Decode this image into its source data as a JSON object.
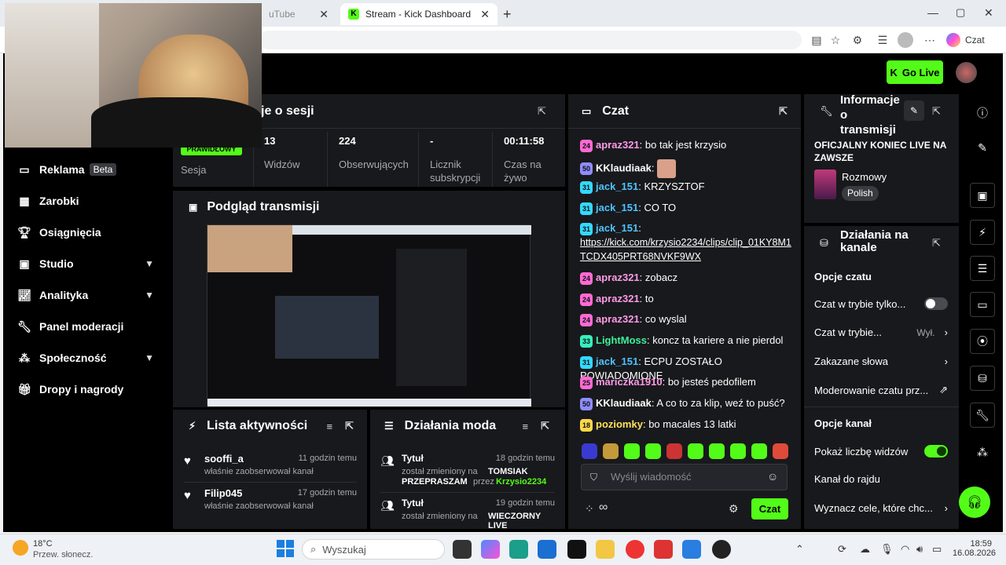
{
  "browser": {
    "tabs": [
      {
        "label": "uTube",
        "active": false
      },
      {
        "label": "Stream - Kick Dashboard",
        "active": true
      }
    ],
    "profile_label": "Czat"
  },
  "header": {
    "go_live_label": "Go Live"
  },
  "sidebar": {
    "items": [
      {
        "label": "Reklama",
        "badge": "Beta",
        "icon": "ad-icon"
      },
      {
        "label": "Zarobki",
        "icon": "money-icon"
      },
      {
        "label": "Osiągnięcia",
        "icon": "trophy-icon"
      },
      {
        "label": "Studio",
        "icon": "studio-icon",
        "expandable": true
      },
      {
        "label": "Analityka",
        "icon": "chart-icon",
        "expandable": true
      },
      {
        "label": "Panel moderacji",
        "icon": "wrench-icon"
      },
      {
        "label": "Społeczność",
        "icon": "community-icon",
        "expandable": true
      },
      {
        "label": "Dropy i nagrody",
        "icon": "gift-icon"
      }
    ]
  },
  "session": {
    "title": "je o sesji",
    "status_badge": "PRAWIDŁOWY",
    "stats": [
      {
        "value": "",
        "label": "Sesja"
      },
      {
        "value": "13",
        "label": "Widzów"
      },
      {
        "value": "224",
        "label": "Obserwujących"
      },
      {
        "value": "-",
        "label": "Licznik subskrypcji"
      },
      {
        "value": "00:11:58",
        "label": "Czas na żywo"
      }
    ]
  },
  "preview": {
    "title": "Podgląd transmisji"
  },
  "activity": {
    "title": "Lista aktywności",
    "items": [
      {
        "user": "sooffi_a",
        "time": "11 godzin temu",
        "text": "właśnie zaobserwował kanał"
      },
      {
        "user": "Filip045",
        "time": "17 godzin temu",
        "text": "właśnie zaobserwował kanał"
      }
    ]
  },
  "mod_actions": {
    "title": "Działania moda",
    "items": [
      {
        "title": "Tytuł",
        "time": "18 godzin temu",
        "line1": "został zmieniony na",
        "bold1": "TOMSIAK",
        "line2": "PRZEPRASZAM",
        "by": "przez",
        "mod": "Krzysio2234"
      },
      {
        "title": "Tytuł",
        "time": "19 godzin temu",
        "line1": "został zmieniony na",
        "bold1": "WIECZORNY LIVE"
      }
    ]
  },
  "chat": {
    "title": "Czat",
    "messages": [
      {
        "badge": "24",
        "badge_color": "#ff6ad5",
        "user": "apraz321",
        "user_color": "#ff9ae8",
        "text": "bo tak jest krzysio"
      },
      {
        "badge": "50",
        "badge_color": "#8f8cff",
        "user": "KKlaudiaak",
        "user_color": "#ffffff",
        "text": ""
      },
      {
        "badge": "31",
        "badge_color": "#34d9ff",
        "user": "jack_151",
        "user_color": "#4fc3ff",
        "text": "KRZYSZTOF"
      },
      {
        "badge": "31",
        "badge_color": "#34d9ff",
        "user": "jack_151",
        "user_color": "#4fc3ff",
        "text": "CO TO"
      },
      {
        "badge": "31",
        "badge_color": "#34d9ff",
        "user": "jack_151",
        "user_color": "#4fc3ff",
        "text": "",
        "link": "https://kick.com/krzysio2234/clips/clip_01KY8M1TCDX405PRT68NVKF9WX"
      },
      {
        "badge": "24",
        "badge_color": "#ff6ad5",
        "user": "apraz321",
        "user_color": "#ff9ae8",
        "text": "zobacz"
      },
      {
        "badge": "24",
        "badge_color": "#ff6ad5",
        "user": "apraz321",
        "user_color": "#ff9ae8",
        "text": "to"
      },
      {
        "badge": "24",
        "badge_color": "#ff6ad5",
        "user": "apraz321",
        "user_color": "#ff9ae8",
        "text": "co wyslal"
      },
      {
        "badge": "33",
        "badge_color": "#36f0c0",
        "user": "LightMoss",
        "user_color": "#3ef09a",
        "text": "koncz ta kariere a nie pierdol"
      },
      {
        "badge": "31",
        "badge_color": "#34d9ff",
        "user": "jack_151",
        "user_color": "#4fc3ff",
        "text": "ECPU ZOSTAŁO POWIADOMIONE"
      },
      {
        "badge": "25",
        "badge_color": "#ff6ad5",
        "user": "mariczka1910",
        "user_color": "#ff9ae8",
        "text": "bo jesteś pedofilem"
      },
      {
        "badge": "50",
        "badge_color": "#8f8cff",
        "user": "KKlaudiaak",
        "user_color": "#ffffff",
        "text": "A co to za klip, weź to puść?"
      },
      {
        "badge": "18",
        "badge_color": "#ffd84a",
        "user": "poziomky",
        "user_color": "#ffe25a",
        "text": "bo macales 13 latki"
      }
    ],
    "input_placeholder": "Wyślij wiadomość",
    "send_label": "Czat"
  },
  "stream_info": {
    "title": "Informacje o transmisji",
    "stream_title": "OFICJALNY KONIEC LIVE NA ZAWSZE",
    "category": "Rozmowy",
    "language": "Polish"
  },
  "channel_actions": {
    "title": "Działania na kanale",
    "chat_options_heading": "Opcje czatu",
    "rows": [
      {
        "label": "Czat w trybie tylko...",
        "type": "toggle",
        "on": false
      },
      {
        "label": "Czat w trybie...",
        "value": "Wył.",
        "type": "chevron"
      },
      {
        "label": "Zakazane słowa",
        "type": "chevron"
      },
      {
        "label": "Moderowanie czatu prz...",
        "type": "external"
      }
    ],
    "channel_options_heading": "Opcje kanał",
    "rows2": [
      {
        "label": "Pokaż liczbę widzów",
        "type": "toggle",
        "on": true
      },
      {
        "label": "Kanał do rajdu",
        "type": "none"
      },
      {
        "label": "Wyznacz cele, które chc...",
        "type": "chevron"
      }
    ]
  },
  "taskbar": {
    "weather_temp": "18°C",
    "weather_desc": "Przew. słonecz.",
    "search_placeholder": "Wyszukaj",
    "time": "18:59",
    "date": "16.08.2026"
  },
  "colors": {
    "accent": "#53fc18",
    "panel": "#18191c",
    "background": "#000000"
  }
}
